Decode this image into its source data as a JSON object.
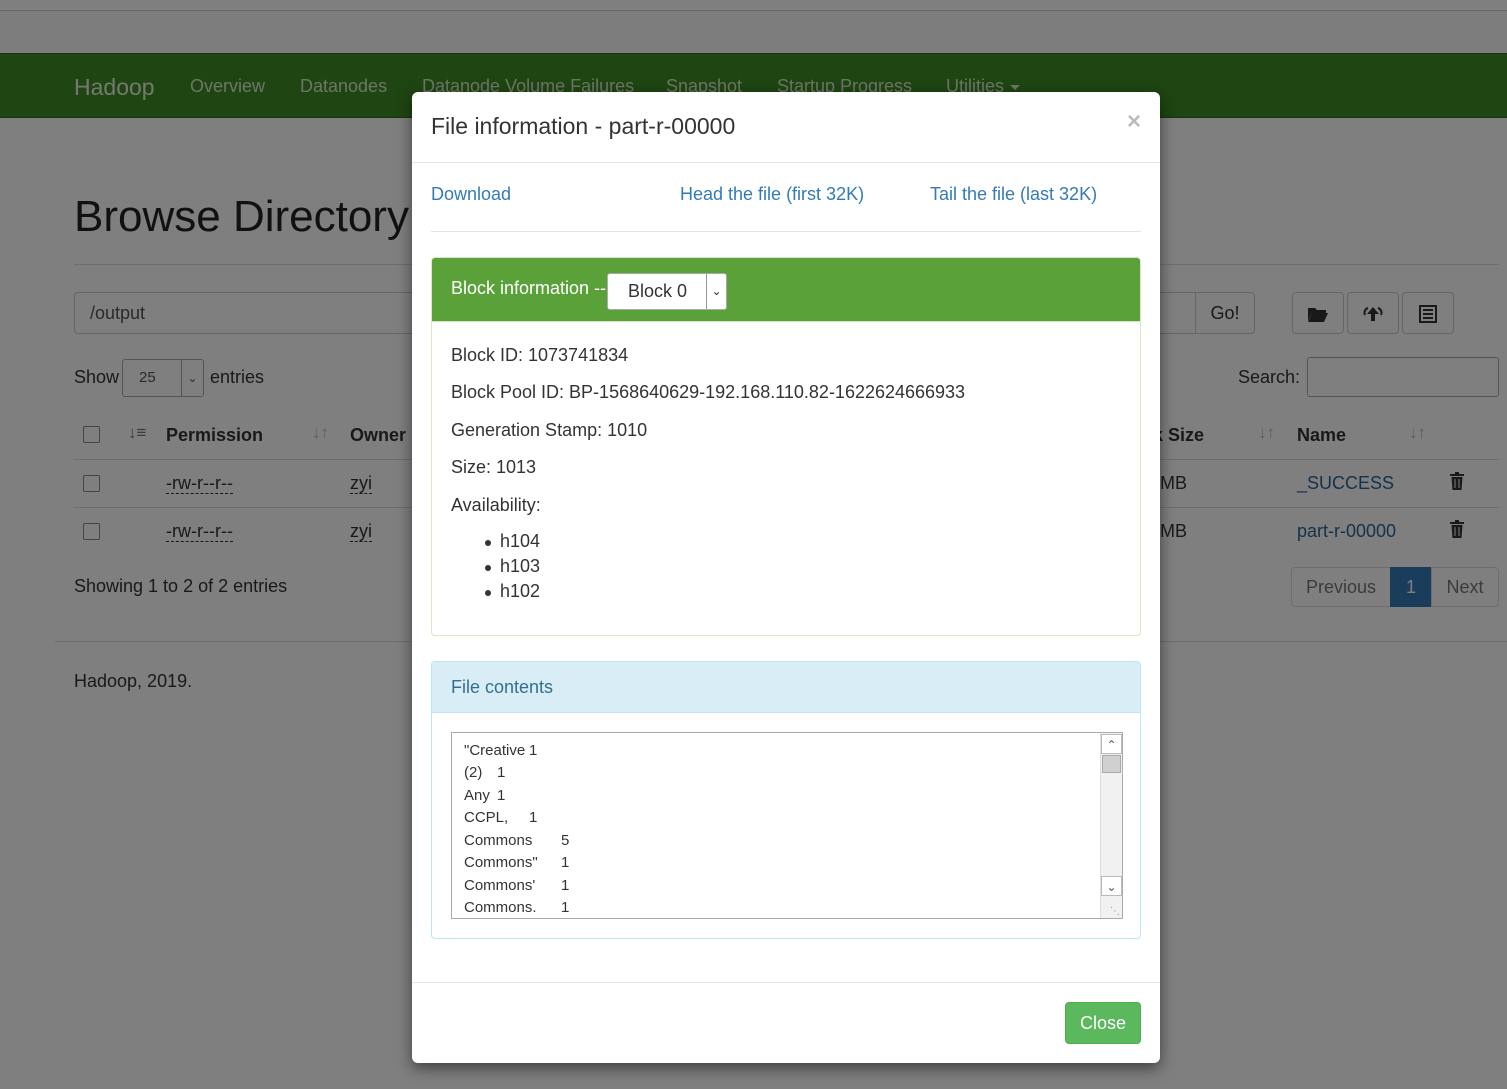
{
  "navbar": {
    "brand": "Hadoop",
    "links": [
      "Overview",
      "Datanodes",
      "Datanode Volume Failures",
      "Snapshot",
      "Startup Progress",
      "Utilities"
    ]
  },
  "page": {
    "title": "Browse Directory",
    "path": "/output",
    "go_label": "Go!",
    "show_label": "Show",
    "entries_value": "25",
    "entries_label": "entries",
    "search_label": "Search:",
    "showing_text": "Showing 1 to 2 of 2 entries",
    "footer": "Hadoop, 2019."
  },
  "table": {
    "headers": {
      "permission": "Permission",
      "owner": "Owner",
      "block_size": "k Size",
      "name": "Name"
    },
    "rows": [
      {
        "permission": "-rw-r--r--",
        "owner": "zyi",
        "block_size": "MB",
        "name": "_SUCCESS"
      },
      {
        "permission": "-rw-r--r--",
        "owner": "zyi",
        "block_size": "MB",
        "name": "part-r-00000"
      }
    ]
  },
  "pagination": {
    "previous": "Previous",
    "current": "1",
    "next": "Next"
  },
  "modal": {
    "title": "File information - part-r-00000",
    "close_x": "×",
    "download": "Download",
    "head": "Head the file (first 32K)",
    "tail": "Tail the file (last 32K)",
    "block_label": "Block information --",
    "block_selected": "Block 0",
    "block_id": "Block ID: 1073741834",
    "block_pool_id": "Block Pool ID: BP-1568640629-192.168.110.82-1622624666933",
    "generation_stamp": "Generation Stamp: 1010",
    "size": "Size: 1013",
    "availability_label": "Availability:",
    "availability": [
      "h104",
      "h103",
      "h102"
    ],
    "contents_label": "File contents",
    "contents": [
      {
        "word": "\"Creative",
        "count": "1"
      },
      {
        "word": "(2)",
        "count": "1"
      },
      {
        "word": "Any",
        "count": "1"
      },
      {
        "word": "CCPL,",
        "count": "1"
      },
      {
        "word": "Commons",
        "count": "5"
      },
      {
        "word": "Commons\"",
        "count": "1"
      },
      {
        "word": "Commons'",
        "count": "1"
      },
      {
        "word": "Commons.",
        "count": "1"
      }
    ],
    "close_button": "Close"
  },
  "colors": {
    "navbar": "#3f8b25",
    "block_header": "#5aa13a",
    "contents_header": "#d9edf7",
    "close_button": "#5cb85c",
    "link": "#337ab7"
  }
}
